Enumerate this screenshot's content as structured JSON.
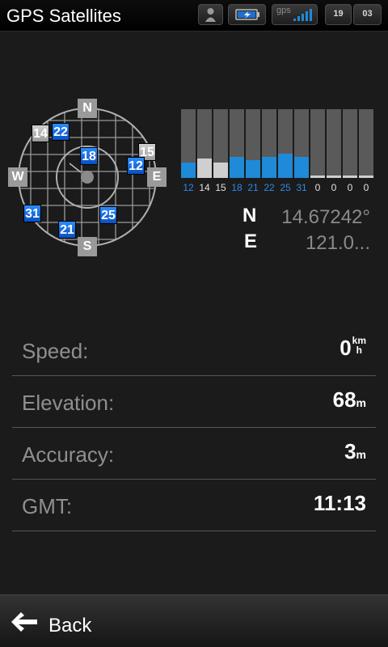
{
  "app_title": "GPS Satellites",
  "status_bar": {
    "gps_label": "gps",
    "time_hour": "19",
    "time_minute": "03",
    "icons": [
      "profile-icon",
      "battery-icon",
      "gps-signal-icon"
    ]
  },
  "skyplot": {
    "directions": {
      "n": "N",
      "s": "S",
      "e": "E",
      "w": "W"
    },
    "satellites": [
      {
        "id": "14",
        "state": "inactive"
      },
      {
        "id": "22",
        "state": "active"
      },
      {
        "id": "18",
        "state": "active"
      },
      {
        "id": "15",
        "state": "inactive"
      },
      {
        "id": "12",
        "state": "active"
      },
      {
        "id": "31",
        "state": "active"
      },
      {
        "id": "25",
        "state": "active"
      },
      {
        "id": "21",
        "state": "active"
      }
    ]
  },
  "signal_bars": [
    {
      "id": "12",
      "level": 0.22,
      "color": "#1e8ad8"
    },
    {
      "id": "14",
      "level": 0.28,
      "color": "#cfcfcf"
    },
    {
      "id": "15",
      "level": 0.22,
      "color": "#cfcfcf"
    },
    {
      "id": "18",
      "level": 0.3,
      "color": "#1e8ad8"
    },
    {
      "id": "21",
      "level": 0.26,
      "color": "#1e8ad8"
    },
    {
      "id": "22",
      "level": 0.3,
      "color": "#1e8ad8"
    },
    {
      "id": "25",
      "level": 0.35,
      "color": "#1e8ad8"
    },
    {
      "id": "31",
      "level": 0.3,
      "color": "#1e8ad8"
    },
    {
      "id": "0",
      "level": 0.03,
      "color": "#cfcfcf"
    },
    {
      "id": "0",
      "level": 0.03,
      "color": "#cfcfcf"
    },
    {
      "id": "0",
      "level": 0.03,
      "color": "#cfcfcf"
    },
    {
      "id": "0",
      "level": 0.03,
      "color": "#cfcfcf"
    }
  ],
  "colors": {
    "active": "#1e8ad8",
    "inactive": "#cfcfcf"
  },
  "coordinates": {
    "lat_letter": "N",
    "lat_value": "14.67242°",
    "lon_letter": "E",
    "lon_value": "121.0..."
  },
  "stats": {
    "speed_label": "Speed:",
    "speed_value": "0",
    "speed_unit_top": "km",
    "speed_unit_bottom": "h",
    "elevation_label": "Elevation:",
    "elevation_value": "68",
    "elevation_unit": "m",
    "accuracy_label": "Accuracy:",
    "accuracy_value": "3",
    "accuracy_unit": "m",
    "gmt_label": "GMT:",
    "gmt_value": "11:13"
  },
  "bottom_bar": {
    "back_label": "Back"
  }
}
